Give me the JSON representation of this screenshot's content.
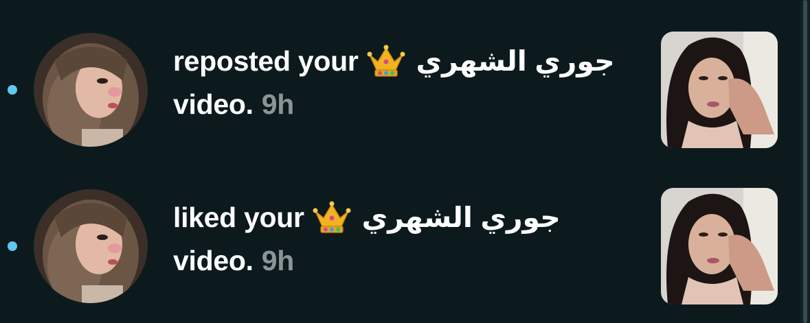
{
  "colors": {
    "background": "#0c1a1e",
    "unread_dot": "#5ec8f0",
    "timestamp": "#8b9497",
    "text": "#ffffff"
  },
  "notifications": [
    {
      "action": "reposted your",
      "crown_icon": "crown-emoji",
      "username": "جوري الشهري",
      "object": "video.",
      "time": "9h",
      "unread": true
    },
    {
      "action": "liked your",
      "crown_icon": "crown-emoji",
      "username": "جوري الشهري",
      "object": "video.",
      "time": "9h",
      "unread": true
    }
  ]
}
